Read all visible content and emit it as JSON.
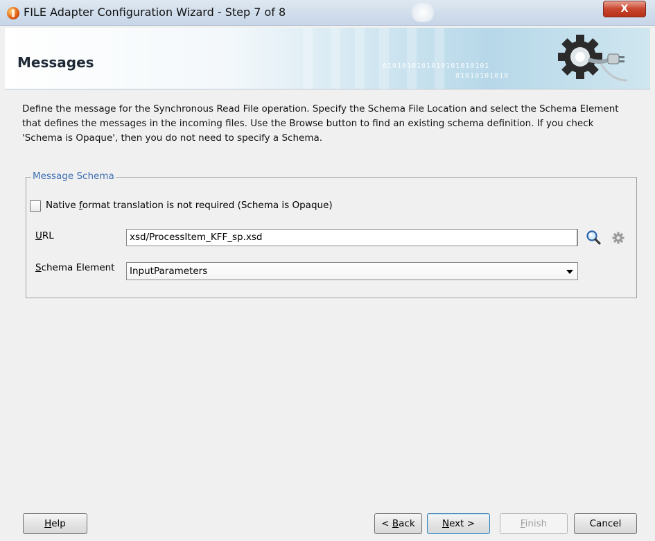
{
  "window": {
    "title": "FILE Adapter Configuration Wizard - Step 7 of 8",
    "close_label": "X"
  },
  "header": {
    "title": "Messages",
    "decor_binary_1": "0101010101010101010101",
    "decor_binary_2": "01010101010"
  },
  "description": "Define the message for the Synchronous Read File operation.  Specify the Schema File Location and select the Schema Element that defines the messages in the incoming files. Use the Browse button to find an existing schema definition. If you check 'Schema is Opaque', then you do not need to specify a Schema.",
  "message_schema": {
    "legend": "Message Schema",
    "opaque_checkbox": {
      "checked": false,
      "label_before": "Native ",
      "label_mnemonic": "f",
      "label_after": "ormat translation is not required (Schema is Opaque)"
    },
    "url": {
      "label_mnemonic": "U",
      "label_rest": "RL",
      "value": "xsd/ProcessItem_KFF_sp.xsd"
    },
    "schema_element": {
      "label_mnemonic": "S",
      "label_rest": "chema Element",
      "value": "InputParameters"
    }
  },
  "buttons": {
    "help": {
      "mnemonic": "H",
      "rest": "elp"
    },
    "back": {
      "prefix": "< ",
      "mnemonic": "B",
      "rest": "ack"
    },
    "next": {
      "mnemonic": "N",
      "rest": "ext >"
    },
    "finish": {
      "mnemonic": "F",
      "rest": "inish",
      "enabled": false
    },
    "cancel": {
      "label": "Cancel"
    }
  },
  "colors": {
    "legend": "#3c6fb0",
    "close_button": "#c9462e",
    "default_button_border": "#3c7fb1"
  }
}
